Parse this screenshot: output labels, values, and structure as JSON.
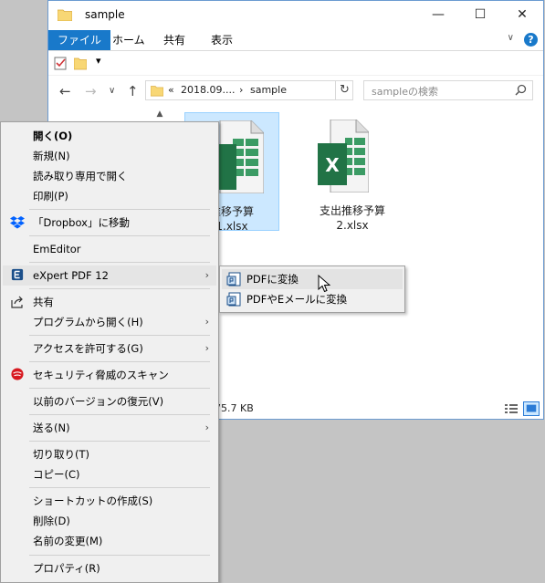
{
  "window": {
    "title": "sample",
    "minimize": "—",
    "maximize": "☐",
    "close": "✕"
  },
  "ribbon": {
    "tabs": [
      {
        "label": "ファイル",
        "active": true
      },
      {
        "label": "ホーム",
        "active": false
      },
      {
        "label": "共有",
        "active": false
      },
      {
        "label": "表示",
        "active": false
      }
    ],
    "expand": "∨",
    "help": "?"
  },
  "qat": {
    "dropdown": "▾"
  },
  "nav": {
    "back": "←",
    "forward": "→",
    "recent": "∨",
    "up": "↑",
    "refresh": "↻"
  },
  "address": {
    "prefix": "«",
    "crumb1": "2018.09....",
    "sep": "›",
    "crumb2": "sample"
  },
  "search": {
    "placeholder": "sampleの検索"
  },
  "files": [
    {
      "name_line1": "推移予算",
      "name_line2": "1.xlsx",
      "selected": true
    },
    {
      "name_line1": "支出推移予算",
      "name_line2": "2.xlsx",
      "selected": false
    }
  ],
  "status": {
    "size": "75.7 KB"
  },
  "context_menu": {
    "open": "開く(O)",
    "new": "新規(N)",
    "open_readonly": "読み取り専用で開く",
    "print": "印刷(P)",
    "dropbox": "「Dropbox」に移動",
    "emeditor": "EmEditor",
    "expert_pdf": "eXpert PDF 12",
    "share": "共有",
    "open_with": "プログラムから開く(H)",
    "give_access": "アクセスを許可する(G)",
    "scan": "セキュリティ脅威のスキャン",
    "restore": "以前のバージョンの復元(V)",
    "send_to": "送る(N)",
    "cut": "切り取り(T)",
    "copy": "コピー(C)",
    "create_shortcut": "ショートカットの作成(S)",
    "delete": "削除(D)",
    "rename": "名前の変更(M)",
    "properties": "プロパティ(R)",
    "arrow": "›"
  },
  "submenu": {
    "to_pdf": "PDFに変換",
    "to_pdf_email": "PDFやEメールに変換"
  },
  "colors": {
    "accent": "#1979ca",
    "selection": "#cce8ff",
    "excel_green": "#217346",
    "folder_yellow": "#f8d775"
  }
}
